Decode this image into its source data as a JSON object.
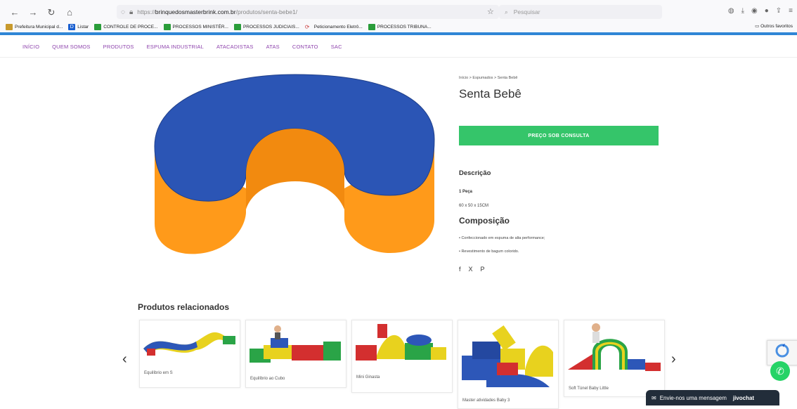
{
  "browser": {
    "url_prefix": "https://",
    "url_host": "brinquedosmasterbrink.com.br",
    "url_path": "/produtos/senta-bebe1/",
    "search_placeholder": "Pesquisar",
    "bookmarks": [
      {
        "label": "Prefeitura Municipal d...",
        "icon": "municipal-icon"
      },
      {
        "label": "Listar",
        "icon": "d-icon"
      },
      {
        "label": "CONTROLE DE PROCE...",
        "icon": "green-flag-icon"
      },
      {
        "label": "PROCESSOS MINISTÉR...",
        "icon": "green-flag-icon"
      },
      {
        "label": "PROCESSOS JUDICIAIS...",
        "icon": "green-flag-icon"
      },
      {
        "label": "Peticionamento Eletrô...",
        "icon": "pje-icon"
      },
      {
        "label": "PROCESSOS TRIBUNA...",
        "icon": "green-flag-icon"
      }
    ],
    "other_bookmarks": "Outros favoritos"
  },
  "nav": [
    "INÍCIO",
    "QUEM SOMOS",
    "PRODUTOS",
    "ESPUMA INDUSTRIAL",
    "ATACADISTAS",
    "ATAS",
    "CONTATO",
    "SAC"
  ],
  "product": {
    "breadcrumb": "Início  >  Espumados  >  Senta Bebê",
    "title": "Senta Bebê",
    "price_button": "PREÇO SOB CONSULTA",
    "desc_heading": "Descrição",
    "pieces": "1 Peça",
    "dimensions": "60 x 50 x 15CM",
    "composition_heading": "Composição",
    "bullets": [
      "• Confeccionado em espuma de alta performance;",
      "• Revestimento de bagum colorido."
    ]
  },
  "social": [
    "f",
    "X",
    "P"
  ],
  "related": {
    "heading": "Produtos relacionados",
    "items": [
      "Equilíbrio em S",
      "Equilíbrio ao Cubo",
      "Mini Ginasta",
      "Master atividades Baby 3",
      "Soft Túnel Baby Little"
    ]
  },
  "chat": {
    "label": "Envie-nos uma mensagem",
    "brand": "jivochat"
  },
  "colors": {
    "accent": "#2f86d6",
    "nav": "#8e44ad",
    "price_button": "#35c56a",
    "whatsapp": "#25d366"
  }
}
